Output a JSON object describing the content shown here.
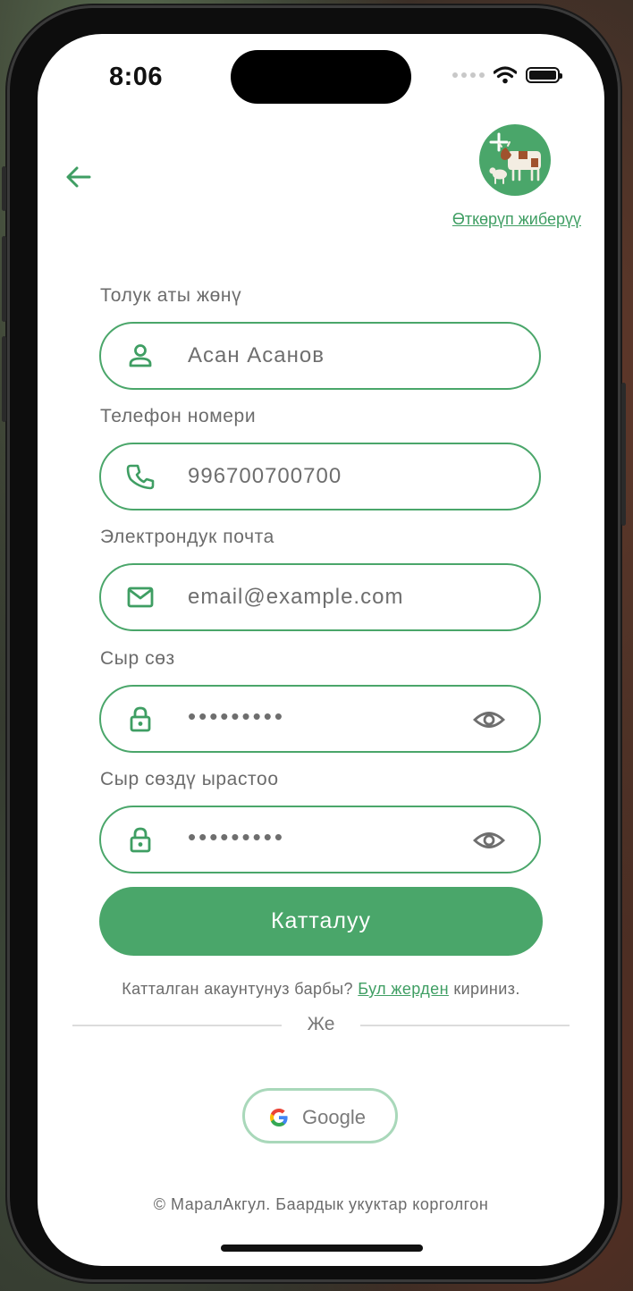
{
  "status_bar": {
    "time": "8:06"
  },
  "header": {
    "skip_label": "Өткөрүп жиберүү"
  },
  "form": {
    "full_name": {
      "label": "Толук аты жөнү",
      "placeholder": "Асан Асанов"
    },
    "phone": {
      "label": "Телефон номери",
      "placeholder": "996700700700"
    },
    "email": {
      "label": "Электрондук почта",
      "placeholder": "email@example.com"
    },
    "password": {
      "label": "Сыр сөз",
      "value": "•••••••••"
    },
    "confirm_password": {
      "label": "Сыр сөздү ырастоо",
      "value": "•••••••••"
    },
    "submit_label": "Катталуу"
  },
  "login_prompt": {
    "text_before": "Катталган акаунтунуз барбы? ",
    "link": "Бул жерден",
    "text_after": " кириниз."
  },
  "divider_text": "Же",
  "google_button": {
    "label": "Google"
  },
  "footer": "© МаралАкгул. Баардык укуктар корголгон",
  "colors": {
    "accent": "#4aa66a",
    "border_light": "#a9d8ba",
    "text_muted": "#6b6b6b"
  }
}
